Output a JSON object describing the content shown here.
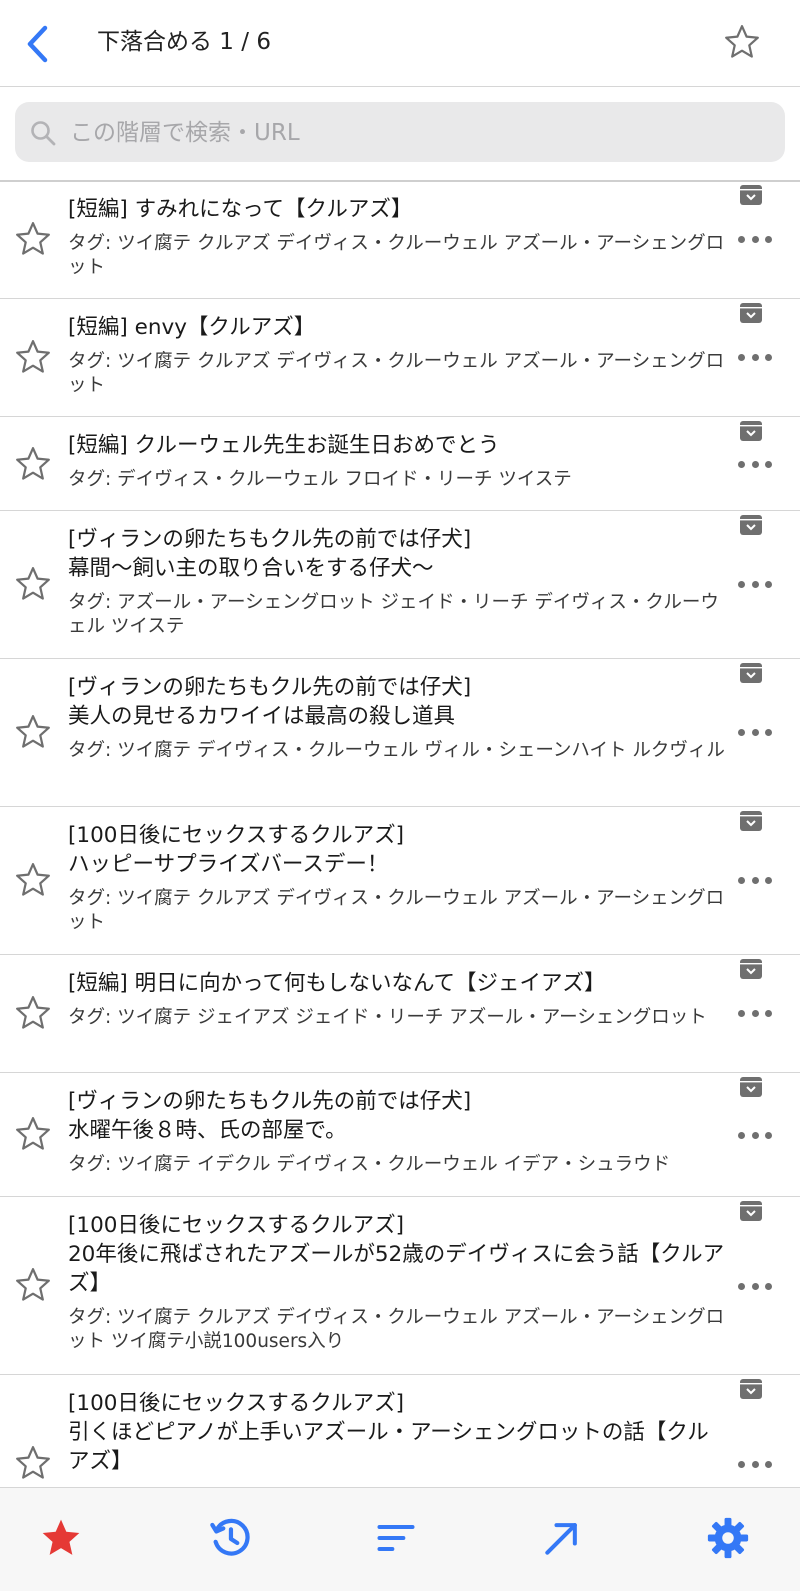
{
  "header": {
    "title": "下落合める 1 / 6",
    "back_icon": "chevron-left-icon",
    "favorite_icon": "star-outline-icon"
  },
  "search": {
    "placeholder": "この階層で検索・URL",
    "value": ""
  },
  "colors": {
    "accent": "#3478f6",
    "favorite": "#e53935",
    "icon_gray": "#6f6f6f"
  },
  "rows": [
    {
      "title": "[短編] すみれになって【クルアズ】",
      "tags": "タグ: ツイ腐テ クルアズ デイヴィス・クルーウェル アズール・アーシェングロット"
    },
    {
      "title": "[短編] envy【クルアズ】",
      "tags": "タグ: ツイ腐テ クルアズ デイヴィス・クルーウェル アズール・アーシェングロット"
    },
    {
      "title": "[短編] クルーウェル先生お誕生日おめでとう",
      "tags": "タグ: デイヴィス・クルーウェル フロイド・リーチ ツイステ"
    },
    {
      "title": "[ヴィランの卵たちもクル先の前では仔犬]\n幕間〜飼い主の取り合いをする仔犬〜",
      "tags": "タグ: アズール・アーシェングロット ジェイド・リーチ デイヴィス・クルーウェル ツイステ"
    },
    {
      "title": "[ヴィランの卵たちもクル先の前では仔犬]\n美人の見せるカワイイは最高の殺し道具",
      "tags": "タグ: ツイ腐テ デイヴィス・クルーウェル ヴィル・シェーンハイト ルクヴィル"
    },
    {
      "title": "[100日後にセックスするクルアズ]\nハッピーサプライズバースデー！",
      "tags": "タグ: ツイ腐テ クルアズ デイヴィス・クルーウェル アズール・アーシェングロット"
    },
    {
      "title": "[短編] 明日に向かって何もしないなんて【ジェイアズ】",
      "tags": "タグ: ツイ腐テ ジェイアズ ジェイド・リーチ アズール・アーシェングロット"
    },
    {
      "title": "[ヴィランの卵たちもクル先の前では仔犬]\n水曜午後８時、氏の部屋で。",
      "tags": "タグ: ツイ腐テ イデクル デイヴィス・クルーウェル イデア・シュラウド"
    },
    {
      "title": "[100日後にセックスするクルアズ]\n20年後に飛ばされたアズールが52歳のデイヴィスに会う話【クルアズ】",
      "tags": "タグ: ツイ腐テ クルアズ デイヴィス・クルーウェル アズール・アーシェングロット ツイ腐テ小説100users入り"
    },
    {
      "title": "[100日後にセックスするクルアズ]\n引くほどピアノが上手いアズール・アーシェングロットの話【クルアズ】",
      "tags": ""
    }
  ],
  "tabbar": [
    {
      "name": "tab-favorites",
      "icon": "star-filled-icon"
    },
    {
      "name": "tab-history",
      "icon": "history-icon"
    },
    {
      "name": "tab-sort",
      "icon": "sort-icon"
    },
    {
      "name": "tab-jump",
      "icon": "arrow-up-right-icon"
    },
    {
      "name": "tab-settings",
      "icon": "gear-icon"
    }
  ]
}
